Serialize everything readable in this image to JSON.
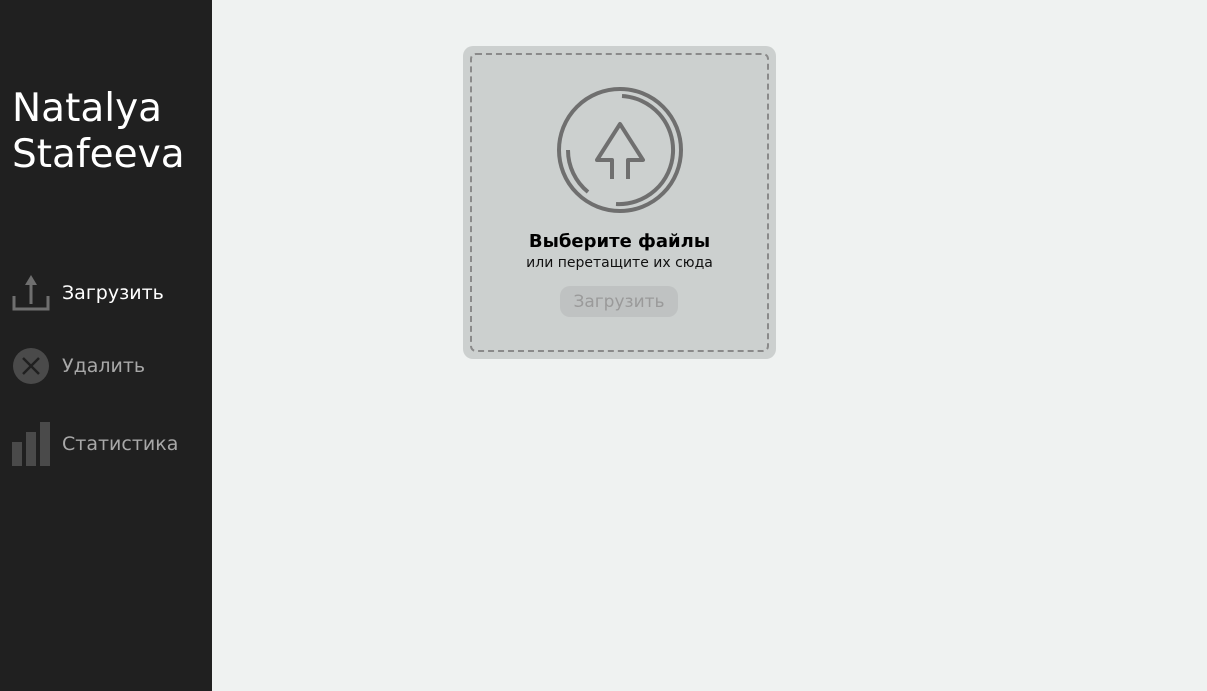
{
  "sidebar": {
    "brand_line1": "Natalya",
    "brand_line2": "Stafeeva",
    "items": [
      {
        "label": "Загрузить",
        "icon": "upload-icon",
        "active": true
      },
      {
        "label": "Удалить",
        "icon": "delete-icon",
        "active": false
      },
      {
        "label": "Статистика",
        "icon": "stats-icon",
        "active": false
      }
    ]
  },
  "dropzone": {
    "icon": "upload-arrow-icon",
    "title": "Выберите файлы",
    "subtitle": "или перетащите их сюда",
    "button_label": "Загрузить"
  },
  "colors": {
    "sidebar_bg": "#202020",
    "page_bg": "#eff2f1",
    "dropzone_bg": "#ccd0cf",
    "icon_gray": "#6f6f6f"
  }
}
